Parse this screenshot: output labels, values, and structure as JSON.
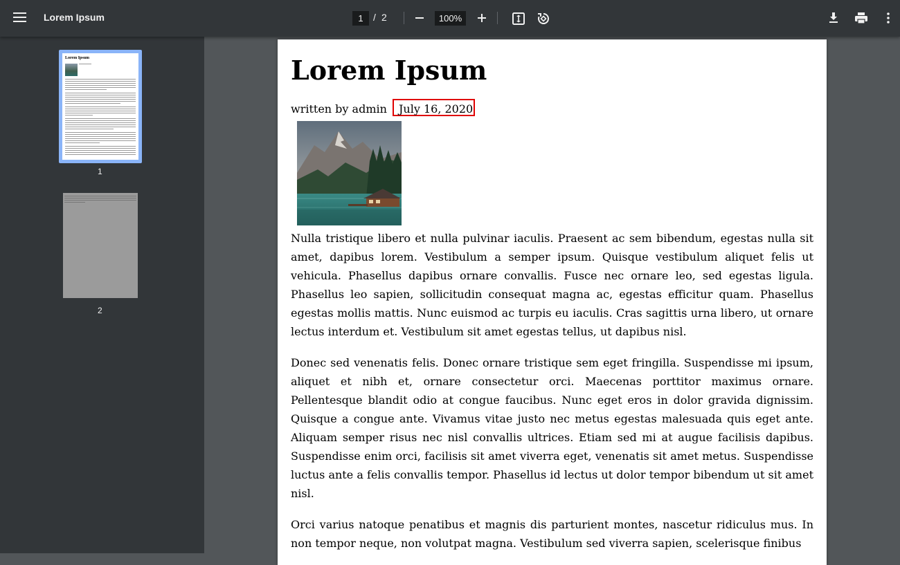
{
  "toolbar": {
    "title": "Lorem Ipsum",
    "current_page": "1",
    "page_separator": "/",
    "total_pages": "2",
    "zoom": "100%"
  },
  "sidebar": {
    "thumbnails": [
      {
        "number": "1",
        "title": "Lorem Ipsum",
        "selected": true
      },
      {
        "number": "2",
        "selected": false
      }
    ]
  },
  "document": {
    "title": "Lorem Ipsum",
    "byline": "written by admin",
    "date": "July 16, 2020",
    "paragraphs": [
      "Nulla tristique libero et nulla pulvinar iaculis. Praesent ac sem bibendum, egestas nulla sit amet, dapibus lorem. Vestibulum a semper ipsum. Quisque vestibulum aliquet felis ut vehicula. Phasellus dapibus ornare convallis. Fusce nec ornare leo, sed egestas ligula. Phasellus leo sapien, sollicitudin consequat magna ac, egestas efficitur quam. Phasellus egestas mollis mattis. Nunc euismod ac turpis eu iaculis. Cras sagittis urna libero, ut ornare lectus interdum et. Vestibulum sit amet egestas tellus, ut dapibus nisl.",
      "Donec sed venenatis felis. Donec ornare tristique sem eget fringilla. Suspendisse mi ipsum, aliquet et nibh et, ornare consectetur orci. Maecenas porttitor maximus ornare. Pellentesque blandit odio at congue faucibus. Nunc eget eros in dolor gravida dignissim. Quisque a congue ante. Vivamus vitae justo nec metus egestas malesuada quis eget ante. Aliquam semper risus nec nisl convallis ultrices. Etiam sed mi at augue facilisis dapibus. Suspendisse enim orci, facilisis sit amet viverra eget, venenatis sit amet metus. Suspendisse luctus ante a felis convallis tempor. Phasellus id lectus ut dolor tempor bibendum ut sit amet nisl.",
      "Orci varius natoque penatibus et magnis dis parturient montes, nascetur ridiculus mus. In non tempor neque, non volutpat magna. Vestibulum sed viverra sapien, scelerisque finibus"
    ]
  },
  "colors": {
    "toolbar_bg": "#323639",
    "viewer_bg": "#525659",
    "thumb_selected": "#8ab4f8",
    "highlight_box": "#e00000"
  },
  "icons": [
    "menu-icon",
    "zoom-out-icon",
    "zoom-in-icon",
    "fit-page-icon",
    "rotate-icon",
    "download-icon",
    "print-icon",
    "more-vert-icon"
  ]
}
